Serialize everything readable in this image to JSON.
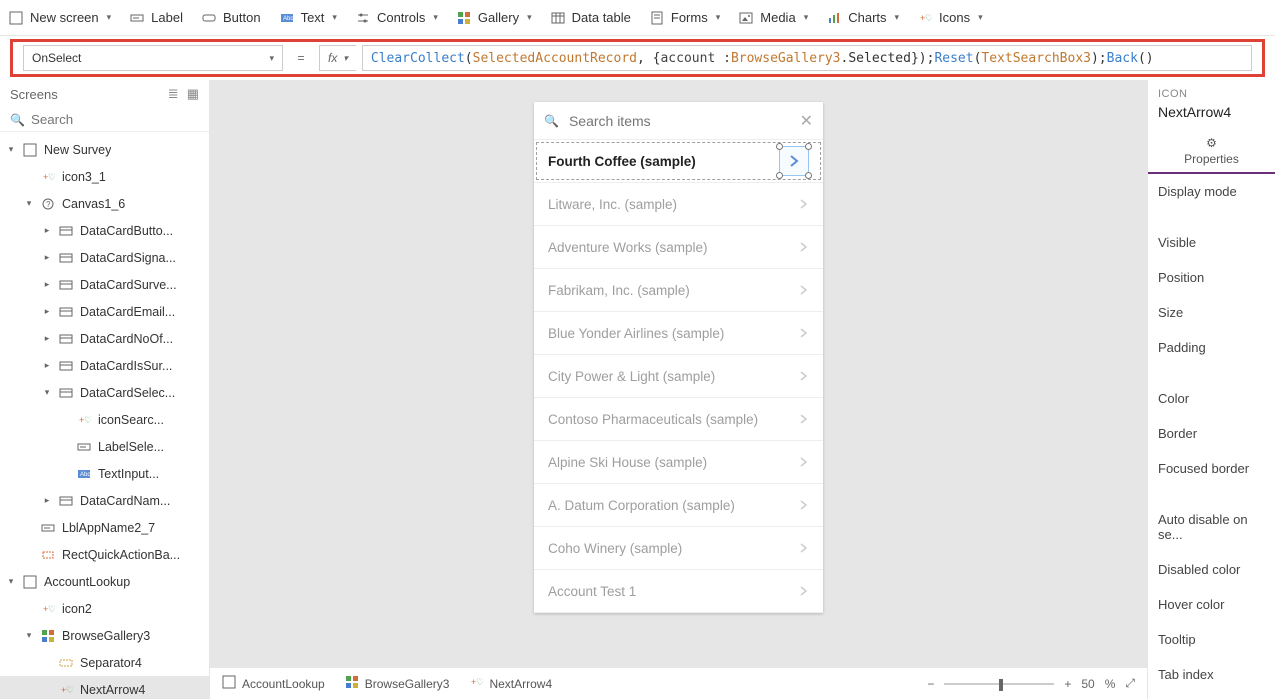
{
  "ribbon": [
    {
      "label": "New screen",
      "hasChevron": true,
      "icon": "screen"
    },
    {
      "label": "Label",
      "hasChevron": false,
      "icon": "label"
    },
    {
      "label": "Button",
      "hasChevron": false,
      "icon": "button"
    },
    {
      "label": "Text",
      "hasChevron": true,
      "icon": "text"
    },
    {
      "label": "Controls",
      "hasChevron": true,
      "icon": "controls"
    },
    {
      "label": "Gallery",
      "hasChevron": true,
      "icon": "gallery"
    },
    {
      "label": "Data table",
      "hasChevron": false,
      "icon": "datatable"
    },
    {
      "label": "Forms",
      "hasChevron": true,
      "icon": "forms"
    },
    {
      "label": "Media",
      "hasChevron": true,
      "icon": "media"
    },
    {
      "label": "Charts",
      "hasChevron": true,
      "icon": "charts"
    },
    {
      "label": "Icons",
      "hasChevron": true,
      "icon": "icons"
    }
  ],
  "formula": {
    "property": "OnSelect",
    "fx_label": "fx",
    "tokens": [
      {
        "t": "ClearCollect",
        "c": "c-func"
      },
      {
        "t": "(",
        "c": "c-punct"
      },
      {
        "t": "SelectedAccountRecord",
        "c": "c-id"
      },
      {
        "t": " , {",
        "c": "c-punct"
      },
      {
        "t": "account : ",
        "c": "c-str"
      },
      {
        "t": "BrowseGallery3",
        "c": "c-id"
      },
      {
        "t": ".Selected});",
        "c": "c-punct"
      },
      {
        "t": "Reset",
        "c": "c-func"
      },
      {
        "t": "(",
        "c": "c-punct"
      },
      {
        "t": "TextSearchBox3",
        "c": "c-id"
      },
      {
        "t": ");",
        "c": "c-punct"
      },
      {
        "t": "Back",
        "c": "c-func"
      },
      {
        "t": "()",
        "c": "c-punct"
      }
    ]
  },
  "left": {
    "title": "Screens",
    "search_placeholder": "Search",
    "tree": [
      {
        "d": 0,
        "t": "▾",
        "i": "screen",
        "l": "New Survey"
      },
      {
        "d": 1,
        "t": "",
        "i": "icons",
        "l": "icon3_1"
      },
      {
        "d": 1,
        "t": "▾",
        "i": "canvas",
        "l": "Canvas1_6"
      },
      {
        "d": 2,
        "t": "▸",
        "i": "card",
        "l": "DataCardButto..."
      },
      {
        "d": 2,
        "t": "▸",
        "i": "card",
        "l": "DataCardSigna..."
      },
      {
        "d": 2,
        "t": "▸",
        "i": "card",
        "l": "DataCardSurve..."
      },
      {
        "d": 2,
        "t": "▸",
        "i": "card",
        "l": "DataCardEmail..."
      },
      {
        "d": 2,
        "t": "▸",
        "i": "card",
        "l": "DataCardNoOf..."
      },
      {
        "d": 2,
        "t": "▸",
        "i": "card",
        "l": "DataCardIsSur..."
      },
      {
        "d": 2,
        "t": "▾",
        "i": "card",
        "l": "DataCardSelec..."
      },
      {
        "d": 3,
        "t": "",
        "i": "icons",
        "l": "iconSearc..."
      },
      {
        "d": 3,
        "t": "",
        "i": "label",
        "l": "LabelSele..."
      },
      {
        "d": 3,
        "t": "",
        "i": "text",
        "l": "TextInput..."
      },
      {
        "d": 2,
        "t": "▸",
        "i": "card",
        "l": "DataCardNam..."
      },
      {
        "d": 1,
        "t": "",
        "i": "label",
        "l": "LblAppName2_7"
      },
      {
        "d": 1,
        "t": "",
        "i": "rect",
        "l": "RectQuickActionBa..."
      },
      {
        "d": 0,
        "t": "▾",
        "i": "screen",
        "l": "AccountLookup"
      },
      {
        "d": 1,
        "t": "",
        "i": "icons",
        "l": "icon2"
      },
      {
        "d": 1,
        "t": "▾",
        "i": "gallery",
        "l": "BrowseGallery3"
      },
      {
        "d": 2,
        "t": "",
        "i": "sep",
        "l": "Separator4"
      },
      {
        "d": 2,
        "t": "",
        "i": "icons",
        "l": "NextArrow4",
        "sel": true
      }
    ]
  },
  "canvasApp": {
    "search_placeholder": "Search items",
    "rows": [
      {
        "label": "Fourth Coffee (sample)",
        "selected": true
      },
      {
        "label": "Litware, Inc. (sample)"
      },
      {
        "label": "Adventure Works (sample)"
      },
      {
        "label": "Fabrikam, Inc. (sample)"
      },
      {
        "label": "Blue Yonder Airlines (sample)"
      },
      {
        "label": "City Power & Light (sample)"
      },
      {
        "label": "Contoso Pharmaceuticals (sample)"
      },
      {
        "label": "Alpine Ski House (sample)"
      },
      {
        "label": "A. Datum Corporation (sample)"
      },
      {
        "label": "Coho Winery (sample)"
      },
      {
        "label": "Account Test 1"
      }
    ]
  },
  "breadcrumb": [
    {
      "label": "AccountLookup",
      "icon": "screen"
    },
    {
      "label": "BrowseGallery3",
      "icon": "gallery"
    },
    {
      "label": "NextArrow4",
      "icon": "icons"
    }
  ],
  "zoom": {
    "percent": "50",
    "suffix": "%",
    "pos": 50
  },
  "right": {
    "header": "ICON",
    "name": "NextArrow4",
    "tab": "Properties",
    "props": [
      "Display mode",
      "Visible",
      "Position",
      "Size",
      "Padding",
      "Color",
      "Border",
      "Focused border",
      "Auto disable on se...",
      "Disabled color",
      "Hover color",
      "Tooltip",
      "Tab index"
    ]
  }
}
